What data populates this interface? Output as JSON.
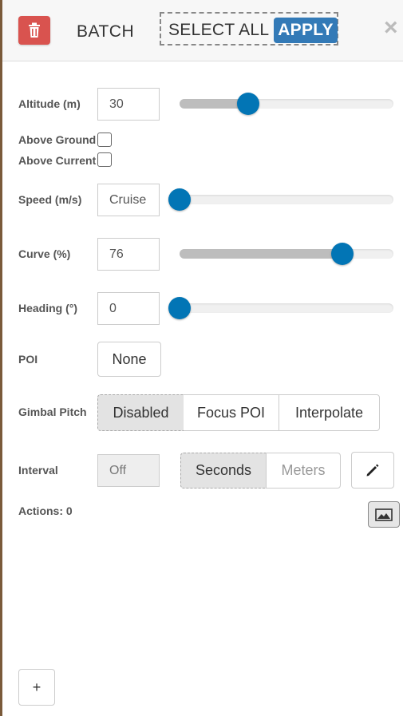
{
  "header": {
    "batch_label": "BATCH",
    "select_all_label": "SELECT ALL",
    "apply_label": "APPLY",
    "close_glyph": "×"
  },
  "altitude": {
    "label": "Altitude (m)",
    "value": "30",
    "slider_fraction": 0.32
  },
  "above_ground": {
    "label": "Above Ground",
    "checked": false
  },
  "above_current": {
    "label": "Above Current",
    "checked": false
  },
  "speed": {
    "label": "Speed (m/s)",
    "value": "Cruise",
    "slider_fraction": 0.0
  },
  "curve": {
    "label": "Curve (%)",
    "value": "76",
    "slider_fraction": 0.76
  },
  "heading": {
    "label": "Heading (°)",
    "value": "0",
    "slider_fraction": 0.0
  },
  "poi": {
    "label": "POI",
    "value": "None"
  },
  "gimbal": {
    "label": "Gimbal Pitch",
    "options": [
      "Disabled",
      "Focus POI",
      "Interpolate"
    ],
    "selected": "Disabled"
  },
  "interval": {
    "label": "Interval",
    "value": "Off",
    "units": [
      "Seconds",
      "Meters"
    ],
    "selected_unit": "Seconds"
  },
  "actions": {
    "label": "Actions: 0"
  },
  "add_label": "+",
  "colors": {
    "accent": "#0275b5",
    "apply": "#337ab7",
    "delete": "#d9534f"
  }
}
